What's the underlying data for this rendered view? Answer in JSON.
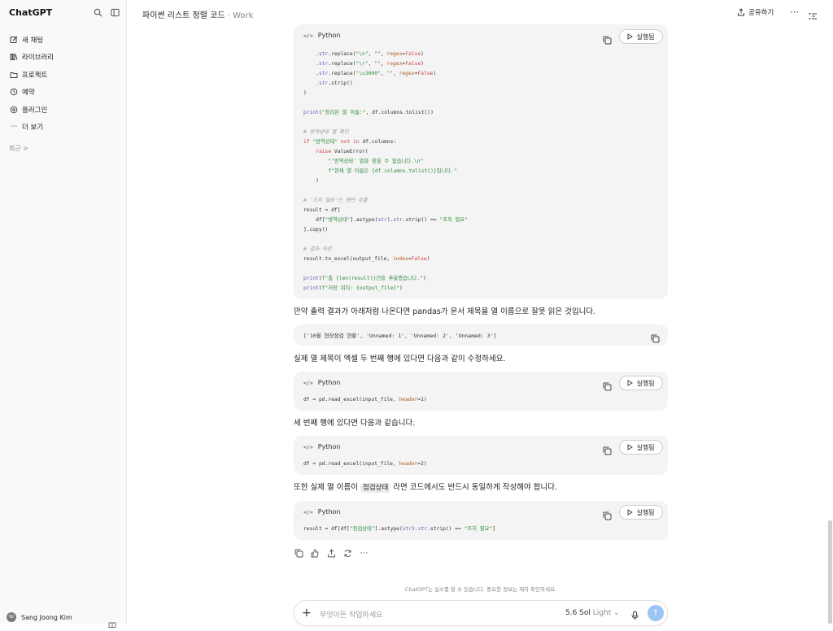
{
  "sidebar": {
    "brand": "ChatGPT",
    "items": [
      {
        "label": "새 채팅",
        "icon": "new-chat-icon"
      },
      {
        "label": "라이브러리",
        "icon": "library-icon"
      },
      {
        "label": "프로젝트",
        "icon": "folder-icon"
      },
      {
        "label": "예약",
        "icon": "clock-icon"
      },
      {
        "label": "플러그인",
        "icon": "plugin-icon"
      },
      {
        "label": "더 보기",
        "icon": "more-icon"
      }
    ],
    "recent": "최근 >",
    "user_name": "Sang Joong Kim",
    "user_initials": "SK"
  },
  "header": {
    "title": "파이썬 리스트 정렬 코드",
    "separator": "·",
    "project": "Work",
    "share_label": "공유하기",
    "more": "⋯"
  },
  "blocks": {
    "lang": "Python",
    "run_label": "실행됨",
    "code1": [
      "    .str.replace(\"\\n\", \"\", regex=False)",
      "    .str.replace(\"\\r\", \"\", regex=False)",
      "    .str.replace(\"\\u3000\", \"\", regex=False)",
      "    .str.strip()",
      ")",
      "",
      "print(\"정리된 열 이름:\", df.columns.tolist())",
      "",
      "# 방역상태 열 확인",
      "if \"방역상태\" not in df.columns:",
      "    raise ValueError(",
      "        \"'방역상태' 열을 찾을 수 없습니다.\\n\"",
      "        f\"현재 열 이름은 {df.columns.tolist()}입니다.\"",
      "    )",
      "",
      "# '조치 필요'인 행만 추출",
      "result = df[",
      "    df[\"방역상태\"].astype(str).str.strip() == \"조치 필요\"",
      "].copy()",
      "",
      "# 결과 저장",
      "result.to_excel(output_file, index=False)",
      "",
      "print(f\"총 {len(result)}건을 추출했습니다.\")",
      "print(f\"저장 위치: {output_file}\")"
    ],
    "para1": "만약 출력 결과가 아래처럼 나온다면 pandas가 문서 제목을 열 이름으로 잘못 읽은 것입니다.",
    "output_line": "['10월 현장점검 현황', 'Unnamed: 1', 'Unnamed: 2', 'Unnamed: 3']",
    "para2": "실제 열 제목이 엑셀 두 번째 행에 있다면 다음과 같이 수정하세요.",
    "code2": "df = pd.read_excel(input_file, header=1)",
    "para3": "세 번째 행에 있다면 다음과 같습니다.",
    "code3": "df = pd.read_excel(input_file, header=2)",
    "para4_pre": "또한 실제 열 이름이 ",
    "para4_code": "점검상태",
    "para4_post": " 라면 코드에서도 반드시 동일하게 작성해야 합니다.",
    "code4": "result = df[df[\"점검상태\"].astype(str).str.strip() == \"조치 필요\"]"
  },
  "footer": {
    "disclaimer": "ChatGPT는 실수를 할 수 있습니다. 중요한 정보는 재차 확인하세요.",
    "placeholder": "무엇이든 작업하세요",
    "model": "5.6 Sol",
    "model_sub": "Light",
    "chevron": "⌄",
    "plus": "+",
    "send": "↑"
  }
}
